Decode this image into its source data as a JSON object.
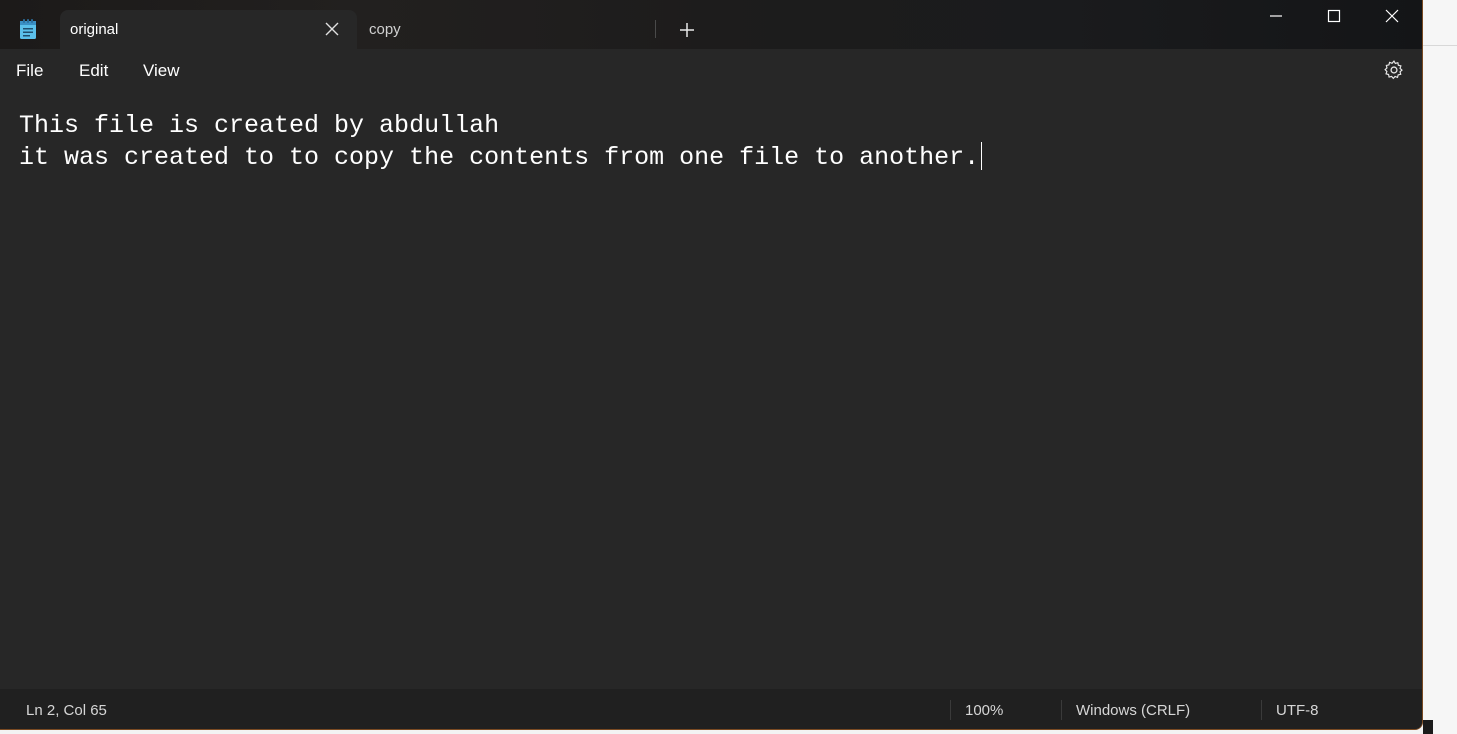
{
  "tabs": [
    {
      "label": "original",
      "active": true
    },
    {
      "label": "copy",
      "active": false
    }
  ],
  "menu": {
    "file": "File",
    "edit": "Edit",
    "view": "View"
  },
  "editor": {
    "lines": [
      "This file is created by abdullah",
      "it was created to to copy the contents from one file to another."
    ]
  },
  "status": {
    "position": "Ln 2, Col 65",
    "zoom": "100%",
    "line_ending": "Windows (CRLF)",
    "encoding": "UTF-8"
  },
  "icons": {
    "app": "notepad-icon",
    "tab_close": "close-icon",
    "new_tab": "plus-icon",
    "minimize": "minimize-icon",
    "maximize": "maximize-icon",
    "close": "close-icon",
    "settings": "gear-icon"
  },
  "colors": {
    "editor_bg": "#272727",
    "titlebar_bg": "#1c1a19",
    "statusbar_bg": "#202020",
    "window_border": "#7a4a22",
    "app_icon": "#5bc0eb"
  }
}
